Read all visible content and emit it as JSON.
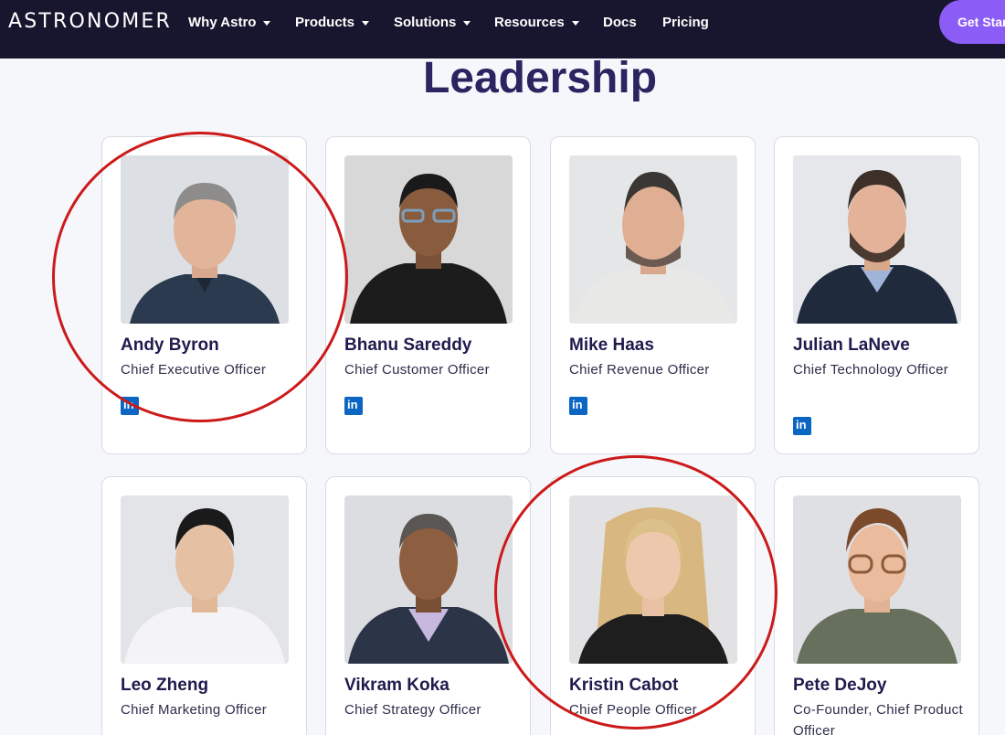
{
  "brand": {
    "logo_text": "ASTRONOMER"
  },
  "nav": {
    "items": [
      {
        "label": "Why Astro",
        "has_menu": true
      },
      {
        "label": "Products",
        "has_menu": true
      },
      {
        "label": "Solutions",
        "has_menu": true
      },
      {
        "label": "Resources",
        "has_menu": true
      },
      {
        "label": "Docs",
        "has_menu": false
      },
      {
        "label": "Pricing",
        "has_menu": false
      }
    ],
    "cta_label": "Get Star"
  },
  "section": {
    "heading": "Leadership"
  },
  "people": [
    {
      "name": "Andy Byron",
      "title": "Chief Executive Officer",
      "highlighted": true
    },
    {
      "name": "Bhanu Sareddy",
      "title": "Chief Customer Officer",
      "highlighted": false
    },
    {
      "name": "Mike Haas",
      "title": "Chief Revenue Officer",
      "highlighted": false
    },
    {
      "name": "Julian LaNeve",
      "title": "Chief Technology Officer",
      "highlighted": false
    },
    {
      "name": "Leo Zheng",
      "title": "Chief Marketing Officer",
      "highlighted": false
    },
    {
      "name": "Vikram Koka",
      "title": "Chief Strategy Officer",
      "highlighted": false
    },
    {
      "name": "Kristin Cabot",
      "title": "Chief People Officer",
      "highlighted": true
    },
    {
      "name": "Pete DeJoy",
      "title": "Co-Founder, Chief Product Officer",
      "highlighted": false
    }
  ],
  "icons": {
    "social": "linkedin-icon"
  },
  "colors": {
    "nav_bg": "#18162e",
    "cta_bg": "#8c5cf6",
    "heading": "#2a2460",
    "linkedin": "#0a66c2",
    "annotation": "#cc1a1a"
  }
}
